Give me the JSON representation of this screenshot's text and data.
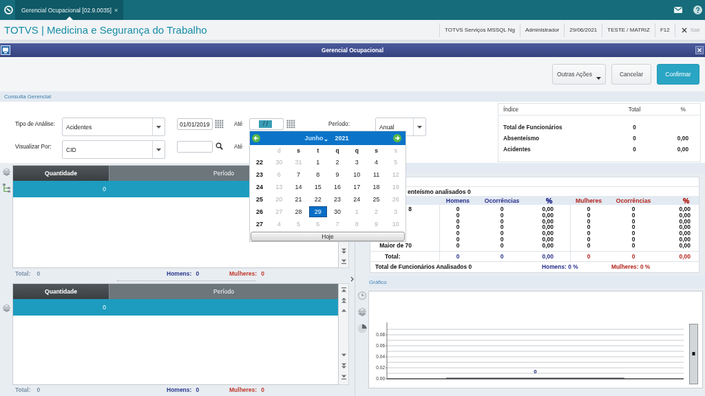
{
  "top_bar": {
    "tab": {
      "label": "Gerencial Ocupacional [02.9.0035]",
      "selected": true,
      "close": "×"
    }
  },
  "header": {
    "title": "TOTVS | Medicina e Segurança do Trabalho",
    "info": [
      "TOTVS Serviços MSSQL Ng",
      "Administrador",
      "29/06/2021",
      "TESTE / MATRIZ",
      "F12"
    ],
    "exit": "Sair"
  },
  "window": {
    "title": "Gerencial Ocupacional"
  },
  "toolbar": {
    "buttons": [
      {
        "label": "Outras Ações",
        "kind": "menu"
      },
      {
        "label": "Cancelar",
        "kind": "cancel"
      },
      {
        "label": "Confirmar",
        "kind": "confirm"
      }
    ]
  },
  "query": {
    "title": "Consulta Gerencial",
    "rows": [
      {
        "label": "Tipo de Análise:",
        "select": "Acidentes",
        "from": {
          "kind": "date",
          "value": "01/01/2019"
        },
        "to_label": "Até",
        "to": {
          "kind": "date",
          "value": "/ /",
          "highlighted": true
        }
      },
      {
        "label": "Visualizar Por:",
        "select": "CID",
        "from": {
          "kind": "lookup"
        },
        "to_label": "Até"
      }
    ],
    "period": {
      "label": "Período:",
      "value": "Anual"
    }
  },
  "index_table": {
    "columns": [
      "Índice",
      "Total",
      "%"
    ],
    "rows": [
      {
        "label": "Total de Funcionários",
        "total": "0"
      },
      {
        "label": "Absenteísmo",
        "total": "0",
        "percent": "0,00"
      },
      {
        "label": "Acidentes",
        "total": "0",
        "percent": "0,00"
      }
    ]
  },
  "calendar": {
    "month": "Junho",
    "year": "2021",
    "weekdays": [
      {
        "label": "d",
        "muted": true
      },
      {
        "label": "s",
        "muted": false
      },
      {
        "label": "t",
        "muted": false
      },
      {
        "label": "q",
        "muted": false
      },
      {
        "label": "q",
        "muted": false
      },
      {
        "label": "s",
        "muted": false
      },
      {
        "label": "s",
        "muted": true
      }
    ],
    "weeks": [
      {
        "week": "22",
        "days": [
          {
            "day": "30",
            "muted": true,
            "selected": false
          },
          {
            "day": "31",
            "muted": true,
            "selected": false
          },
          {
            "day": "1",
            "muted": false,
            "selected": false
          },
          {
            "day": "2",
            "muted": false,
            "selected": false
          },
          {
            "day": "3",
            "muted": false,
            "selected": false
          },
          {
            "day": "4",
            "muted": false,
            "selected": false
          },
          {
            "day": "5",
            "muted": true,
            "selected": false
          }
        ]
      },
      {
        "week": "23",
        "days": [
          {
            "day": "6",
            "muted": true,
            "selected": false
          },
          {
            "day": "7",
            "muted": false,
            "selected": false
          },
          {
            "day": "8",
            "muted": false,
            "selected": false
          },
          {
            "day": "9",
            "muted": false,
            "selected": false
          },
          {
            "day": "10",
            "muted": false,
            "selected": false
          },
          {
            "day": "11",
            "muted": false,
            "selected": false
          },
          {
            "day": "12",
            "muted": true,
            "selected": false
          }
        ]
      },
      {
        "week": "24",
        "days": [
          {
            "day": "13",
            "muted": true,
            "selected": false
          },
          {
            "day": "14",
            "muted": false,
            "selected": false
          },
          {
            "day": "15",
            "muted": false,
            "selected": false
          },
          {
            "day": "16",
            "muted": false,
            "selected": false
          },
          {
            "day": "17",
            "muted": false,
            "selected": false
          },
          {
            "day": "18",
            "muted": false,
            "selected": false
          },
          {
            "day": "19",
            "muted": true,
            "selected": false
          }
        ]
      },
      {
        "week": "25",
        "days": [
          {
            "day": "20",
            "muted": true,
            "selected": false
          },
          {
            "day": "21",
            "muted": false,
            "selected": false
          },
          {
            "day": "22",
            "muted": false,
            "selected": false
          },
          {
            "day": "23",
            "muted": false,
            "selected": false
          },
          {
            "day": "24",
            "muted": false,
            "selected": false
          },
          {
            "day": "25",
            "muted": false,
            "selected": false
          },
          {
            "day": "26",
            "muted": true,
            "selected": false
          }
        ]
      },
      {
        "week": "26",
        "days": [
          {
            "day": "27",
            "muted": true,
            "selected": false
          },
          {
            "day": "28",
            "muted": false,
            "selected": false
          },
          {
            "day": "29",
            "muted": false,
            "selected": true
          },
          {
            "day": "30",
            "muted": false,
            "selected": false
          },
          {
            "day": "1",
            "muted": true,
            "selected": false
          },
          {
            "day": "2",
            "muted": true,
            "selected": false
          },
          {
            "day": "3",
            "muted": true,
            "selected": false
          }
        ]
      },
      {
        "week": "27",
        "days": [
          {
            "day": "4",
            "muted": true,
            "selected": false
          },
          {
            "day": "5",
            "muted": true,
            "selected": false
          },
          {
            "day": "6",
            "muted": true,
            "selected": false
          },
          {
            "day": "7",
            "muted": true,
            "selected": false
          },
          {
            "day": "8",
            "muted": true,
            "selected": false
          },
          {
            "day": "9",
            "muted": true,
            "selected": false
          },
          {
            "day": "10",
            "muted": true,
            "selected": false
          }
        ]
      }
    ],
    "today": "Hoje"
  },
  "grids": [
    {
      "columns": [
        "Quantidade",
        "Período"
      ],
      "rows": [
        {
          "quantity": "0",
          "selected": true
        }
      ],
      "footer": [
        {
          "label": "Total:",
          "value": "0",
          "color": "#7b91a6"
        },
        {
          "label": "Homens:",
          "value": "0",
          "color": "#2c3a8e"
        },
        {
          "label": "Mulheres:",
          "value": "0",
          "color": "#c0392b"
        }
      ]
    },
    {
      "columns": [
        "Quantidade",
        "Período"
      ],
      "rows": [
        {
          "quantity": "0",
          "selected": true
        }
      ],
      "footer": [
        {
          "label": "Total:",
          "value": "0",
          "color": "#7b91a6"
        },
        {
          "label": "Homens:",
          "value": "0",
          "color": "#2c3a8e"
        },
        {
          "label": "Mulheres:",
          "value": "0",
          "color": "#c0392b"
        }
      ]
    }
  ],
  "age_panel": {
    "title": "enteísmo analisados 0",
    "columns": [
      {
        "label": "Homens",
        "color": "#28318c"
      },
      {
        "label": "Ocorrências",
        "color": "#28318c"
      },
      {
        "label": "%",
        "color": "#28318c"
      },
      {
        "label": "Mulheres",
        "color": "#b3261e"
      },
      {
        "label": "Ocorrências",
        "color": "#b3261e"
      },
      {
        "label": "%",
        "color": "#b3261e"
      }
    ],
    "rows": [
      {
        "label": "8",
        "values": [
          "0",
          "0",
          "0,00",
          "0",
          "0",
          "0,00"
        ]
      },
      {
        "values": [
          "0",
          "0",
          "0,00",
          "0",
          "0",
          "0,00"
        ]
      },
      {
        "values": [
          "0",
          "0",
          "0,00",
          "0",
          "0",
          "0,00"
        ]
      },
      {
        "values": [
          "0",
          "0",
          "0,00",
          "0",
          "0",
          "0,00"
        ]
      },
      {
        "values": [
          "0",
          "0",
          "0,00",
          "0",
          "0",
          "0,00"
        ]
      },
      {
        "values": [
          "0",
          "0",
          "0,00",
          "0",
          "0",
          "0,00"
        ]
      },
      {
        "label": "Maior de 70",
        "values": [
          "0",
          "0",
          "0,00",
          "0",
          "0",
          "0,00"
        ]
      }
    ],
    "total": {
      "label": "Total:",
      "values": [
        "0",
        "0",
        "0,00",
        "0",
        "0",
        "0,00"
      ]
    },
    "summary": [
      {
        "text": "Total de Funcionários Analisados 0"
      },
      {
        "text": "Homens: 0 %",
        "color": "#28318c"
      },
      {
        "text": "Mulheres: 0 %",
        "color": "#b3261e"
      }
    ]
  },
  "chart_panel": {
    "title": "Gráfico",
    "chart_data": {
      "type": "bar",
      "values": [
        0
      ],
      "ylim": [
        0,
        0.1
      ],
      "yticks": [
        {
          "value": 0,
          "label": "0.00"
        },
        {
          "value": 0.02,
          "label": "0.02"
        },
        {
          "value": 0.04,
          "label": "0.04"
        },
        {
          "value": 0.06,
          "label": "0.06"
        },
        {
          "value": 0.08,
          "label": "0.08"
        }
      ],
      "grid": true,
      "data_labels": true
    }
  }
}
